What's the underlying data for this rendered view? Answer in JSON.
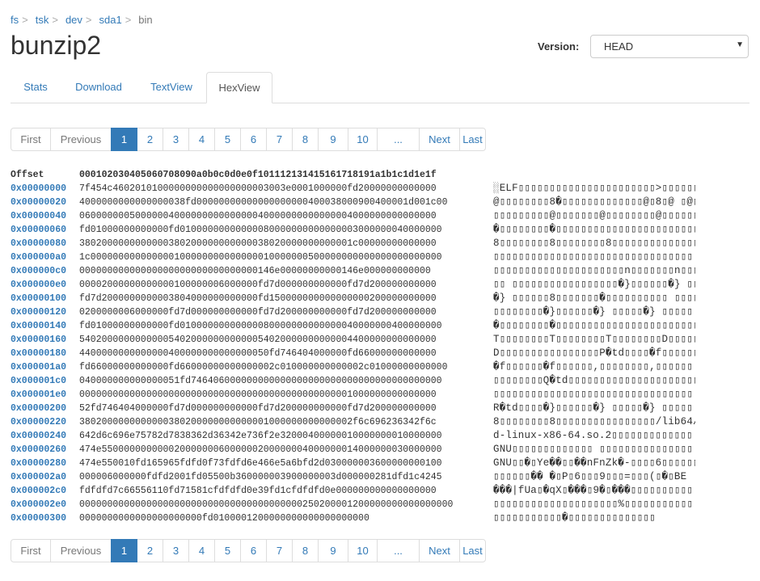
{
  "breadcrumb": [
    {
      "label": "fs",
      "link": true
    },
    {
      "label": "tsk",
      "link": true
    },
    {
      "label": "dev",
      "link": true
    },
    {
      "label": "sda1",
      "link": true
    },
    {
      "label": "bin",
      "link": false
    }
  ],
  "separator": ">",
  "title": "bunzip2",
  "version": {
    "label": "Version:",
    "value": "HEAD"
  },
  "tabs": [
    {
      "label": "Stats",
      "active": false
    },
    {
      "label": "Download",
      "active": false
    },
    {
      "label": "TextView",
      "active": false
    },
    {
      "label": "HexView",
      "active": true
    }
  ],
  "pagination": {
    "labels": [
      "First",
      "Previous",
      "1",
      "2",
      "3",
      "4",
      "5",
      "6",
      "7",
      "8",
      "9",
      "10",
      "...",
      "Next",
      "Last"
    ],
    "active_page": "1",
    "disabled": [
      "First",
      "Previous"
    ]
  },
  "hexview": {
    "header": {
      "offset_label": "Offset",
      "columns": "000102030405060708090a0b0c0d0e0f101112131415161718191a1b1c1d1e1f"
    },
    "rows": [
      {
        "offset": "0x00000000",
        "hex": "7f454c4602010100000000000000000003003e0001000000fd20000000000000",
        "ascii": "░ELF▯▯▯▯▯▯▯▯▯▯▯▯▯▯▯▯▯▯▯▯▯▯>▯▯▯▯▯▯� ▯▯▯▯▯▯▯"
      },
      {
        "offset": "0x00000020",
        "hex": "4000000000000000038fd00000000000000000000400038000900400001d001c00",
        "ascii": "@▯▯▯▯▯▯▯▯8�▯▯▯▯▯▯▯▯▯▯▯▯▯@▯8▯@ ▯@▯▯▯▯▯▯"
      },
      {
        "offset": "0x00000040",
        "hex": "0600000005000000400000000000000040000000000000004000000000000000",
        "ascii": "▯▯▯▯▯▯▯▯▯@▯▯▯▯▯▯▯@▯▯▯▯▯▯▯▯@▯▯▯▯▯▯▯"
      },
      {
        "offset": "0x00000060",
        "hex": "fd01000000000000fd01000000000000080000000000000003000000040000000",
        "ascii": "�▯▯▯▯▯▯▯▯�▯▯▯▯▯▯▯▯▯▯▯▯▯▯▯▯▯▯▯▯▯▯▯"
      },
      {
        "offset": "0x00000080",
        "hex": "3802000000000000380200000000000038020000000000001c00000000000000",
        "ascii": "8▯▯▯▯▯▯▯▯8▯▯▯▯▯▯▯▯8▯▯▯▯▯▯▯▯▯▯▯▯▯▯▯"
      },
      {
        "offset": "0x000000a0",
        "hex": "1c000000000000000100000000000000010000000500000000000000000000000",
        "ascii": "▯▯▯▯▯▯▯▯▯▯▯▯▯▯▯▯▯▯▯▯▯▯▯▯▯▯▯▯▯▯▯▯"
      },
      {
        "offset": "0x000000c0",
        "hex": "00000000000000000000000000000000146e00000000000146e000000000000",
        "ascii": "▯▯▯▯▯▯▯▯▯▯▯▯▯▯▯▯▯▯▯▯▯n▯▯▯▯▯▯▯n▯▯▯▯▯▯"
      },
      {
        "offset": "0x000000e0",
        "hex": "00002000000000000100000006000000fd7d000000000000fd7d200000000000",
        "ascii": "▯▯ ▯▯▯▯▯▯▯▯▯▯▯▯▯▯▯▯▯�}▯▯▯▯▯▯�} ▯▯▯▯▯"
      },
      {
        "offset": "0x00000100",
        "hex": "fd7d2000000000003804000000000000fd150000000000000000200000000000",
        "ascii": "�} ▯▯▯▯▯▯8▯▯▯▯▯▯▯�▯▯▯▯▯▯▯▯▯▯ ▯▯▯▯▯"
      },
      {
        "offset": "0x00000120",
        "hex": "0200000006000000fd7d000000000000fd7d200000000000fd7d200000000000",
        "ascii": "▯▯▯▯▯▯▯▯�}▯▯▯▯▯▯�} ▯▯▯▯▯�} ▯▯▯▯▯"
      },
      {
        "offset": "0x00000140",
        "hex": "fd01000000000000fd01000000000000080000000000000040000000400000000",
        "ascii": "�▯▯▯▯▯▯▯▯�▯▯▯▯▯▯▯▯▯▯▯▯▯▯▯▯▯▯▯▯▯▯▯"
      },
      {
        "offset": "0x00000160",
        "hex": "5402000000000000540200000000000054020000000000004400000000000000",
        "ascii": "T▯▯▯▯▯▯▯▯T▯▯▯▯▯▯▯▯T▯▯▯▯▯▯▯▯D▯▯▯▯▯▯▯"
      },
      {
        "offset": "0x00000180",
        "hex": "4400000000000000400000000000000050fd746404000000fd66000000000000",
        "ascii": "D▯▯▯▯▯▯▯▯▯▯▯▯▯▯▯▯P�td▯▯▯▯�f▯▯▯▯▯▯"
      },
      {
        "offset": "0x000001a0",
        "hex": "fd66000000000000fd66000000000000002c010000000000002c01000000000000",
        "ascii": "�f▯▯▯▯▯▯�f▯▯▯▯▯▯,▯▯▯▯▯▯▯▯,▯▯▯▯▯▯"
      },
      {
        "offset": "0x000001c0",
        "hex": "040000000000000051fd746406000000000000000000000000000000000000000",
        "ascii": "▯▯▯▯▯▯▯▯Q�td▯▯▯▯▯▯▯▯▯▯▯▯▯▯▯▯▯▯▯▯▯"
      },
      {
        "offset": "0x000001e0",
        "hex": "0000000000000000000000000000000000000000000000001000000000000000",
        "ascii": "▯▯▯▯▯▯▯▯▯▯▯▯▯▯▯▯▯▯▯▯▯▯▯▯▯▯▯▯▯▯▯▯"
      },
      {
        "offset": "0x00000200",
        "hex": "52fd746404000000fd7d000000000000fd7d200000000000fd7d200000000000",
        "ascii": "R�td▯▯▯▯�}▯▯▯▯▯▯�} ▯▯▯▯▯�} ▯▯▯▯▯"
      },
      {
        "offset": "0x00000220",
        "hex": "3802000000000000380200000000000001000000000000002f6c696236342f6c",
        "ascii": "8▯▯▯▯▯▯▯▯8▯▯▯▯▯▯▯▯▯▯▯▯▯▯▯▯/lib64/l"
      },
      {
        "offset": "0x00000240",
        "hex": "642d6c696e75782d7838362d36342e736f2e32000400000010000000010000000",
        "ascii": "d-linux-x86-64.so.2▯▯▯▯▯▯▯▯▯▯▯▯▯"
      },
      {
        "offset": "0x00000260",
        "hex": "474e5500000000000200000006000000200000004000000014000000030000000",
        "ascii": "GNU▯▯▯▯▯▯▯▯▯▯▯▯▯ ▯▯▯▯▯▯▯▯▯▯▯▯▯▯▯"
      },
      {
        "offset": "0x00000280",
        "hex": "474e550010fd165965fdfd0f73fdfd6e466e5a6bfd2d030000003600000000100",
        "ascii": "GNU▯▯�▯Ye��▯▯��nFnZk�-▯▯▯▯6▯▯▯▯▯▯"
      },
      {
        "offset": "0x000002a0",
        "hex": "000006000000fdfd2001fd05500b360000003900000003d000000281dfd1c4245",
        "ascii": "▯▯▯▯▯▯�� �▯P▯6▯▯▯9▯▯▯=▯▯▯(▯�▯BE"
      },
      {
        "offset": "0x000002c0",
        "hex": "fdfdfd7c66556110fd71581cfdfdfd0e39fd1cfdfdfd0e000000000000000000",
        "ascii": "���|fUa▯�qX▯���▯9�▯���▯▯▯▯▯▯▯▯▯▯"
      },
      {
        "offset": "0x000002e0",
        "hex": "0000000000000000000000000000000000000000250200001200000000000000000",
        "ascii": "▯▯▯▯▯▯▯▯▯▯▯▯▯▯▯▯▯▯▯▯%▯▯▯▯▯▯▯▯▯▯▯"
      },
      {
        "offset": "0x00000300",
        "hex": "0000000000000000000000fd0100001200000000000000000000",
        "ascii": "▯▯▯▯▯▯▯▯▯▯▯�▯▯▯▯▯▯▯▯▯▯▯▯▯▯"
      }
    ]
  }
}
